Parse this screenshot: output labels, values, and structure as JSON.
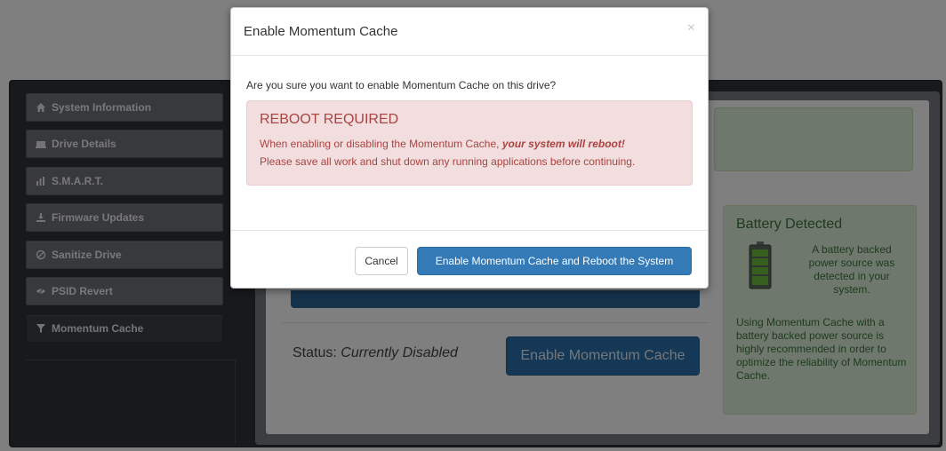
{
  "sidebar": {
    "items": [
      {
        "label": "System Information",
        "icon": "home-icon"
      },
      {
        "label": "Drive Details",
        "icon": "drive-icon"
      },
      {
        "label": "S.M.A.R.T.",
        "icon": "bar-chart-icon"
      },
      {
        "label": "Firmware Updates",
        "icon": "download-icon"
      },
      {
        "label": "Sanitize Drive",
        "icon": "ban-icon"
      },
      {
        "label": "PSID Revert",
        "icon": "eye-slash-icon"
      },
      {
        "label": "Momentum Cache",
        "icon": "filter-icon",
        "active": true
      }
    ]
  },
  "content": {
    "status_label": "Status:",
    "status_value": "Currently Disabled",
    "enable_button": "Enable Momentum Cache",
    "battery": {
      "title": "Battery Detected",
      "description": "A battery backed power source was detected in your system.",
      "note": "Using Momentum Cache with a battery backed power source is highly recommended in order to optimize the reliability of Momentum Cache."
    }
  },
  "modal": {
    "title": "Enable Momentum Cache",
    "close": "×",
    "question": "Are you sure you want to enable Momentum Cache on this drive?",
    "alert_title": "REBOOT REQUIRED",
    "alert_line1_prefix": "When enabling or disabling the Momentum Cache, ",
    "alert_line1_emphasis": "your system will reboot!",
    "alert_line2": "Please save all work and shut down any running applications before continuing.",
    "cancel": "Cancel",
    "confirm": "Enable Momentum Cache and Reboot the System"
  },
  "colors": {
    "primary": "#337ab7",
    "danger_text": "#a94442",
    "danger_bg": "#f2dede",
    "success_bg": "#dff0d8",
    "success_text": "#3c763d",
    "backdrop": "#000000"
  }
}
